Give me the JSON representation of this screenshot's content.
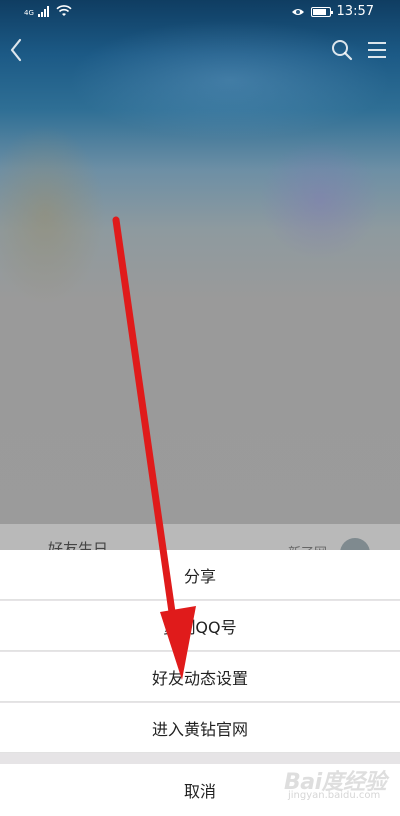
{
  "status_bar": {
    "network": "4G",
    "time": "13:57",
    "battery_level": 0.85,
    "icons": [
      "signal-icon",
      "wifi-icon",
      "eye-icon",
      "battery-icon"
    ]
  },
  "header": {
    "icons": [
      "back-icon",
      "search-icon",
      "menu-icon"
    ]
  },
  "behind_sheet": {
    "title": "好友生日",
    "more": "新了网"
  },
  "action_sheet": {
    "items": [
      {
        "label": "分享"
      },
      {
        "label": "复制QQ号"
      },
      {
        "label": "好友动态设置"
      },
      {
        "label": "进入黄钻官网"
      }
    ],
    "cancel_label": "取消"
  },
  "watermark": {
    "text": "Bai度经验",
    "sub": "jingyan.baidu.com"
  },
  "annotation": {
    "arrow_color": "#e01b1b",
    "points_to": "好友动态设置"
  }
}
